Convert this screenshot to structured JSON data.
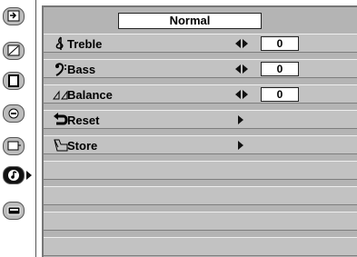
{
  "mode": {
    "label": "Normal"
  },
  "rows": [
    {
      "label": "Treble",
      "value": "0",
      "icon": "treble-clef-icon"
    },
    {
      "label": "Bass",
      "value": "0",
      "icon": "bass-clef-icon"
    },
    {
      "label": "Balance",
      "value": "0",
      "icon": "balance-icon"
    },
    {
      "label": "Reset",
      "icon": "reset-icon"
    },
    {
      "label": "Store",
      "icon": "store-icon"
    }
  ],
  "sidebar": {
    "items": [
      {
        "icon": "input-icon"
      },
      {
        "icon": "image-adjust-icon"
      },
      {
        "icon": "screen-icon"
      },
      {
        "icon": "setting-icon"
      },
      {
        "icon": "pc-adjust-icon"
      },
      {
        "icon": "sound-icon",
        "active": true
      },
      {
        "icon": "projector-icon"
      }
    ]
  },
  "colors": {
    "panel": "#b4b4b4",
    "row": "#c2c2c2",
    "text": "#000000",
    "active": "#111111"
  }
}
